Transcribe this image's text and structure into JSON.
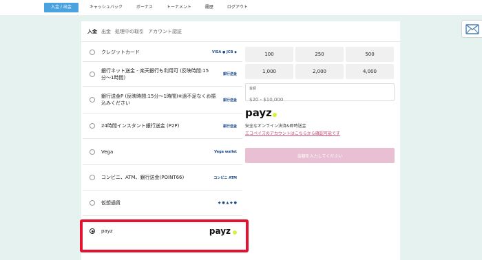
{
  "nav": {
    "items": [
      "入金 / 出金",
      "キャッシュバック",
      "ボーナス",
      "トーナメント",
      "履歴",
      "ログアウト"
    ],
    "active_index": 0
  },
  "tabs": [
    "入金",
    "出金",
    "処理中の取引",
    "アカウント認証"
  ],
  "methods": [
    {
      "label": "クレジットカード",
      "logo": "VISA ● JCB ◆"
    },
    {
      "label": "銀行ネット送金 - 楽天銀行も利用可 (反映時間:15分〜1時間)",
      "logo": "銀行送金"
    },
    {
      "label": "銀行送金P (反映時間:15分〜1時間)※過不足なくお振込みください",
      "logo": "銀行送金"
    },
    {
      "label": "24時間インスタント銀行送金 (P2P)",
      "logo": "銀行送金"
    },
    {
      "label": "Vega",
      "logo": "Vega wallet"
    },
    {
      "label": "コンビニ、ATM、銀行送金(POINT66)",
      "logo": "コンビニ ATM"
    },
    {
      "label": "仮想通貨",
      "logo": "◆ ● ▲ ◆ ●"
    },
    {
      "label": "payz",
      "logo": "payz"
    }
  ],
  "selected_method": 7,
  "amounts": [
    "100",
    "250",
    "500",
    "1,000",
    "2,000",
    "4,000"
  ],
  "amount_field": {
    "label": "金額",
    "placeholder": "$20 - $10,000"
  },
  "brand": {
    "name": "payz",
    "accent": "#d6f23d"
  },
  "description": "安全なオンライン決済&即時送金",
  "link_text": "エコペイズのアカウントはこちらから確認可能です",
  "submit_label": "金額を入力してください",
  "colors": {
    "highlight": "#e3132f",
    "nav_active": "#4aa3df",
    "submit": "#e9bfd3",
    "link": "#c2466c"
  },
  "icons": {
    "mail": "mail-icon"
  }
}
